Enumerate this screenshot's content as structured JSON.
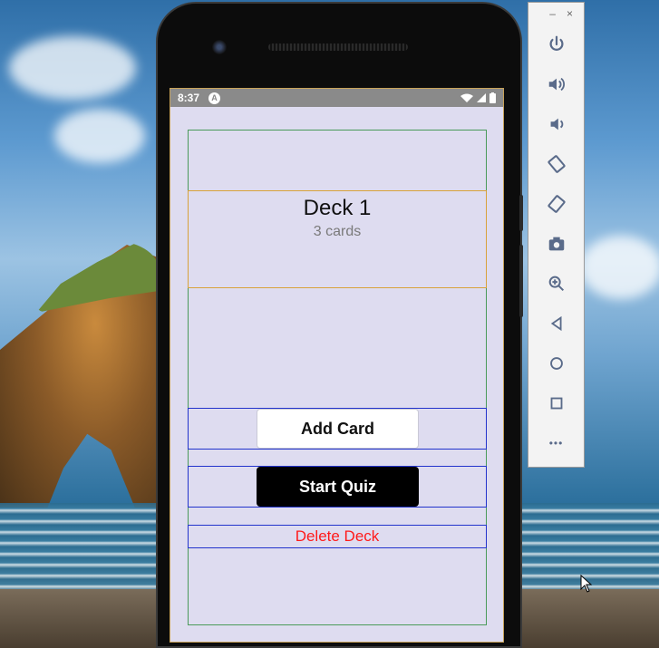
{
  "status_bar": {
    "time": "8:37",
    "launcher_badge": "A"
  },
  "deck": {
    "title": "Deck 1",
    "count_label": "3 cards"
  },
  "actions": {
    "add_card": "Add Card",
    "start_quiz": "Start Quiz",
    "delete_deck": "Delete Deck"
  },
  "emulator_toolbar": {
    "window_controls": [
      "minimize-icon",
      "close-icon"
    ],
    "items": [
      "power-icon",
      "volume-up-icon",
      "volume-down-icon",
      "rotate-left-icon",
      "rotate-right-icon",
      "camera-icon",
      "zoom-icon",
      "back-icon",
      "home-icon",
      "overview-icon",
      "more-icon"
    ],
    "minimize_glyph": "–",
    "close_glyph": "×",
    "more_glyph": "•••"
  },
  "colors": {
    "screen_bg": "#dedcf0",
    "delete_text": "#ff1a1a",
    "quiz_bg": "#000000",
    "add_bg": "#ffffff",
    "debug_green": "#4a9a5a",
    "debug_orange": "#d8a23a",
    "debug_blue": "#2233cc"
  }
}
